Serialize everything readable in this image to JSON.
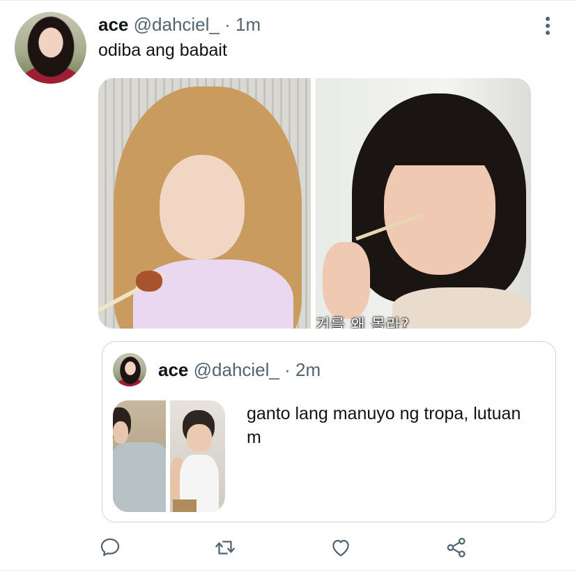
{
  "tweet": {
    "author_name": "ace",
    "author_handle": "@dahciel_",
    "separator": "·",
    "timestamp": "1m",
    "text": "odiba ang babait",
    "media": {
      "photo_2_caption": "거를 왜 몰라?"
    }
  },
  "quoted_tweet": {
    "author_name": "ace",
    "author_handle": "@dahciel_",
    "separator": "·",
    "timestamp": "2m",
    "text": "ganto lang manuyo ng tropa, lutuan m"
  },
  "actions": [
    {
      "name": "reply",
      "icon": "speech-bubble-icon"
    },
    {
      "name": "retweet",
      "icon": "retweet-icon"
    },
    {
      "name": "like",
      "icon": "heart-icon"
    },
    {
      "name": "share",
      "icon": "share-icon"
    }
  ],
  "colors": {
    "text_primary": "#0f1419",
    "text_secondary": "#536471",
    "border": "#cfd9de",
    "icon": "#536471"
  }
}
